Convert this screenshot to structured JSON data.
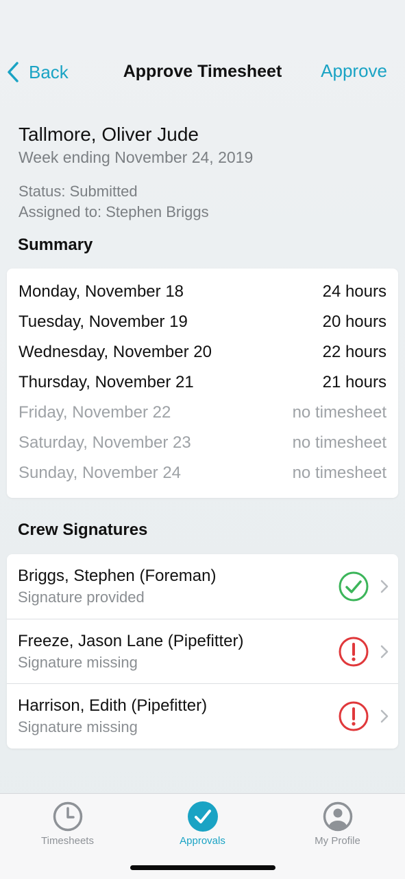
{
  "nav": {
    "back_label": "Back",
    "title": "Approve Timesheet",
    "approve_label": "Approve"
  },
  "employee": {
    "name": "Tallmore, Oliver Jude",
    "week": "Week ending November 24, 2019",
    "status": "Status: Submitted",
    "assigned": "Assigned to: Stephen Briggs"
  },
  "summary": {
    "title": "Summary",
    "days": [
      {
        "day": "Monday, November 18",
        "value": "24 hours"
      },
      {
        "day": "Tuesday, November 19",
        "value": "20 hours"
      },
      {
        "day": "Wednesday, November 20",
        "value": "22 hours"
      },
      {
        "day": "Thursday, November 21",
        "value": "21 hours"
      },
      {
        "day": "Friday, November 22",
        "value": "no timesheet"
      },
      {
        "day": "Saturday, November 23",
        "value": "no timesheet"
      },
      {
        "day": "Sunday, November 24",
        "value": "no timesheet"
      }
    ]
  },
  "signatures": {
    "title": "Crew  Signatures",
    "items": [
      {
        "name": "Briggs, Stephen (Foreman)",
        "status": "Signature provided",
        "icon": "check-circle-icon"
      },
      {
        "name": "Freeze, Jason Lane (Pipefitter)",
        "status": "Signature missing",
        "icon": "alert-circle-icon"
      },
      {
        "name": "Harrison, Edith (Pipefitter)",
        "status": "Signature missing",
        "icon": "alert-circle-icon"
      }
    ]
  },
  "tabs": [
    {
      "label": "Timesheets",
      "icon": "clock-icon"
    },
    {
      "label": "Approvals",
      "icon": "check-icon"
    },
    {
      "label": "My Profile",
      "icon": "user-icon"
    }
  ],
  "colors": {
    "accent": "#1aa3c4",
    "success": "#3cb55a",
    "error": "#e0383b",
    "muted": "#9ea2a6"
  }
}
